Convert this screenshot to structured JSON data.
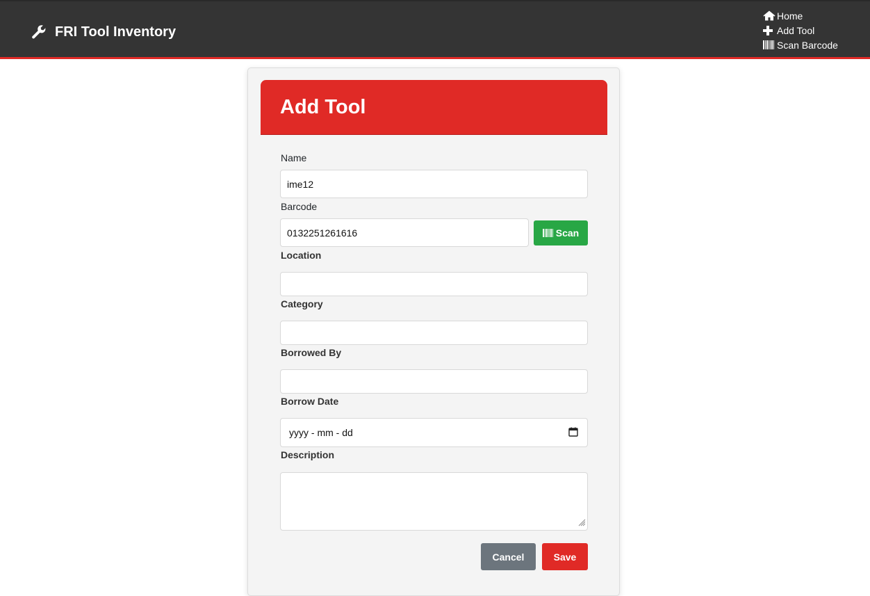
{
  "app": {
    "title": "FRI Tool Inventory",
    "logo_icon": "wrench-icon"
  },
  "nav": {
    "items": [
      {
        "label": "Home",
        "icon": "home-icon"
      },
      {
        "label": "Add Tool",
        "icon": "plus-icon"
      },
      {
        "label": "Scan Barcode",
        "icon": "barcode-icon"
      }
    ]
  },
  "form": {
    "title": "Add Tool",
    "name_label": "Name",
    "name_value": "ime12",
    "barcode_label": "Barcode",
    "barcode_value": "0132251261616",
    "scan_label": "Scan",
    "location_label": "Location",
    "location_value": "",
    "category_label": "Category",
    "category_value": "",
    "borrowed_by_label": "Borrowed By",
    "borrowed_by_value": "",
    "borrow_date_label": "Borrow Date",
    "borrow_date_placeholder": "yyyy - mm - dd",
    "description_label": "Description",
    "description_value": "",
    "cancel_label": "Cancel",
    "save_label": "Save"
  },
  "colors": {
    "navbar": "#343434",
    "accent_red": "#e02a26",
    "scan_green": "#28a745",
    "cancel_gray": "#6c757d"
  }
}
